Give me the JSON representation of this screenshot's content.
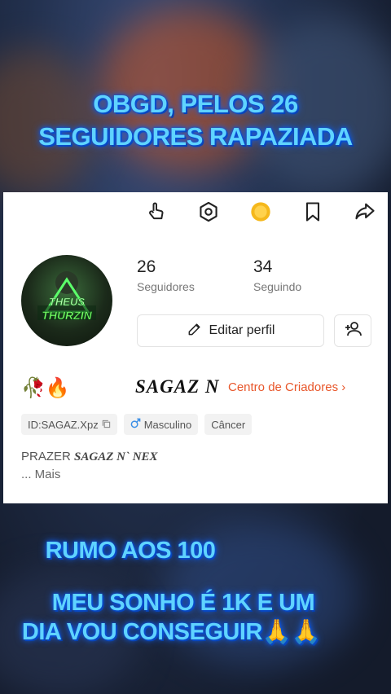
{
  "captions": {
    "top_line1": "OBGD, PELOS 26",
    "top_line2": "SEGUIDORES RAPAZIADA",
    "middle": "RUMO AOS 100",
    "bottom_line1": "MEU SONHO É 1K E UM",
    "bottom_line2": "DIA VOU CONSEGUIR🙏🙏"
  },
  "profile": {
    "followers_count": "26",
    "followers_label": "Seguidores",
    "following_count": "34",
    "following_label": "Seguindo",
    "edit_profile_label": "Editar perfil",
    "emojis": "🥀🔥",
    "nickname": "SAGAZ N",
    "creator_center_label": "Centro de Criadores ›",
    "tags": {
      "id": "ID:SAGAZ.Xpz",
      "gender": "Masculino",
      "sign": "Câncer"
    },
    "bio_prefix": "PRAZER ",
    "bio_name": "SAGAZ N` NEX",
    "more_label": "...  Mais",
    "avatar_text": "Theus Thurzin"
  },
  "icons": [
    "hand-pointer-icon",
    "hexagon-settings-icon",
    "coin-icon",
    "bookmark-icon",
    "share-icon",
    "pencil-icon",
    "add-user-icon",
    "copy-icon",
    "male-icon"
  ],
  "colors": {
    "caption_text": "#5fd3ff",
    "caption_glow": "#0a4fd6",
    "creator_accent": "#e8562a",
    "coin": "#f5b81c",
    "male_icon": "#3a8ee6"
  }
}
